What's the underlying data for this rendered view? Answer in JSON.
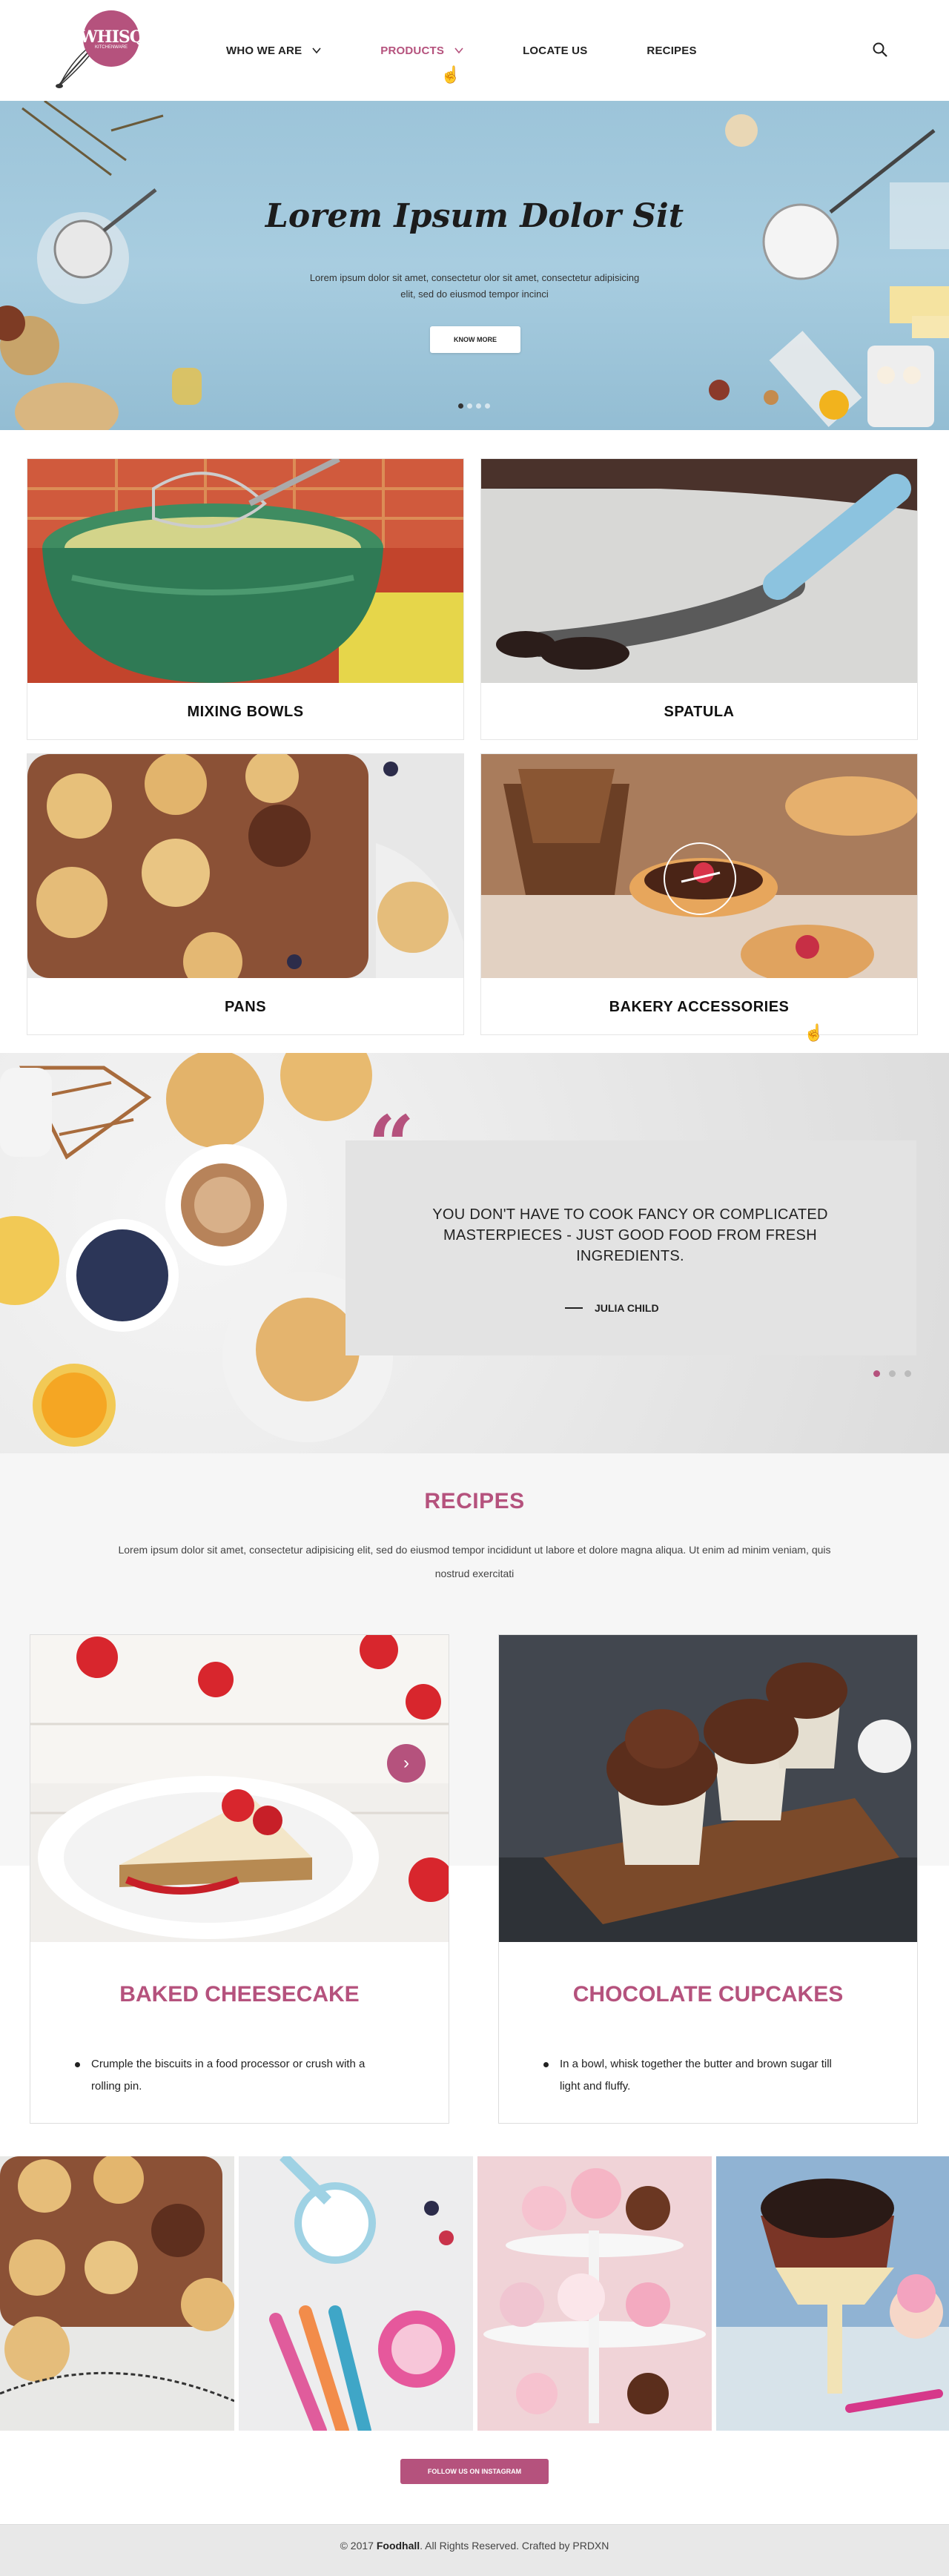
{
  "header": {
    "logo_text": "WHISQ",
    "logo_sub": "KITCHENWARE",
    "nav": [
      {
        "label": "WHO WE ARE",
        "has_dropdown": true
      },
      {
        "label": "PRODUCTS",
        "has_dropdown": true,
        "active": true
      },
      {
        "label": "LOCATE US",
        "has_dropdown": false
      },
      {
        "label": "RECIPES",
        "has_dropdown": false
      }
    ],
    "search_icon": "search-icon"
  },
  "hero": {
    "title": "Lorem Ipsum Dolor Sit",
    "text": "Lorem ipsum dolor sit amet, consectetur olor sit amet, consectetur adipisicing elit, sed do eiusmod tempor incinci",
    "button": "KNOW MORE",
    "slides": 4,
    "active_slide": 1
  },
  "products": [
    {
      "label": "MIXING BOWLS"
    },
    {
      "label": "SPATULA"
    },
    {
      "label": "PANS"
    },
    {
      "label": "BAKERY ACCESSORIES"
    }
  ],
  "quote": {
    "mark": "“",
    "text": "YOU DON'T HAVE TO COOK FANCY OR COMPLICATED MASTERPIECES - JUST GOOD FOOD FROM FRESH INGREDIENTS.",
    "author": "JULIA CHILD",
    "slides": 3,
    "active_slide": 1
  },
  "recipes": {
    "title": "RECIPES",
    "description": "Lorem ipsum dolor sit amet, consectetur adipisicing elit, sed do eiusmod tempor incididunt ut labore et dolore magna aliqua. Ut enim ad minim veniam, quis nostrud exercitati",
    "items": [
      {
        "name": "BAKED CHEESECAKE",
        "step": "Crumple the biscuits in a food processor or crush with a rolling pin."
      },
      {
        "name": "CHOCOLATE CUPCAKES",
        "step": "In a bowl, whisk together the butter and brown sugar till light and fluffy."
      }
    ]
  },
  "instagram": {
    "button": "FOLLOW US ON INSTAGRAM"
  },
  "footer": {
    "copyright": "©  2017",
    "brand": "Foodhall",
    "rest": ". All Rights Reserved. Crafted by PRDXN"
  },
  "colors": {
    "accent": "#b5527d",
    "hero_bg": "#9cc4d9"
  }
}
